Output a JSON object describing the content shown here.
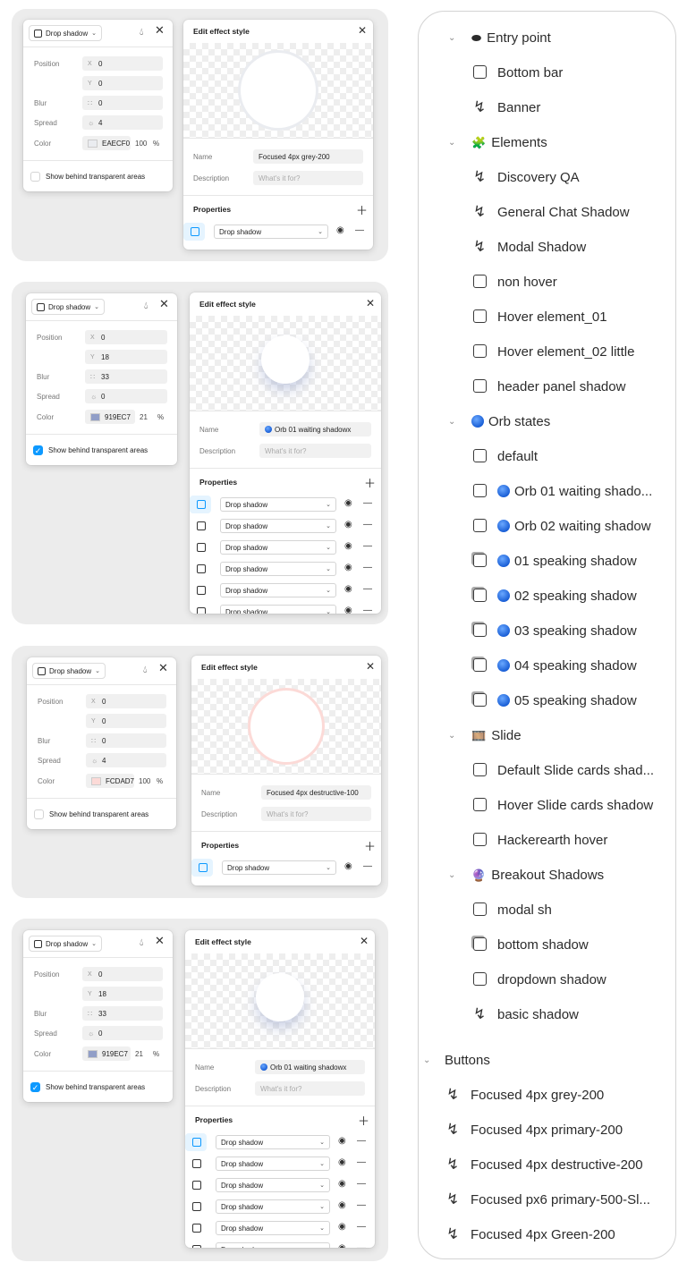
{
  "effect_panel": {
    "type_label": "Drop shadow",
    "labels": {
      "position": "Position",
      "blur": "Blur",
      "spread": "Spread",
      "color": "Color"
    },
    "axis_x": "X",
    "axis_y": "Y",
    "pct_sign": "%",
    "behind_label": "Show behind transparent areas"
  },
  "style_panel": {
    "title": "Edit effect style",
    "name_label": "Name",
    "description_label": "Description",
    "description_placeholder": "What's it for?",
    "properties_label": "Properties",
    "property_dropdown": "Drop shadow"
  },
  "blocks": [
    {
      "x": "0",
      "y": "0",
      "blur": "0",
      "spread": "4",
      "color_hex": "EAECF0",
      "swatch": "#eaecf0",
      "opacity": "100",
      "behind": false,
      "name": "Focused 4px grey-200",
      "name_dot": false,
      "property_rows": 1
    },
    {
      "x": "0",
      "y": "18",
      "blur": "33",
      "spread": "0",
      "color_hex": "919EC7",
      "swatch": "#919ec7",
      "opacity": "21",
      "behind": true,
      "name": "Orb 01 waiting shadowx",
      "name_dot": true,
      "property_rows": 6
    },
    {
      "x": "0",
      "y": "0",
      "blur": "0",
      "spread": "4",
      "color_hex": "FCDAD7",
      "swatch": "#fcdad7",
      "opacity": "100",
      "behind": false,
      "name": "Focused 4px destructive-100",
      "name_dot": false,
      "property_rows": 1
    },
    {
      "x": "0",
      "y": "18",
      "blur": "33",
      "spread": "0",
      "color_hex": "919EC7",
      "swatch": "#919ec7",
      "opacity": "21",
      "behind": true,
      "name": "Orb 01 waiting shadowx",
      "name_dot": true,
      "property_rows": 6
    }
  ],
  "styles_list": {
    "groups": [
      {
        "name": "Entry point",
        "emoji": "⬬",
        "items": [
          {
            "label": "Bottom bar",
            "icon": "square-icon"
          },
          {
            "label": "Banner",
            "icon": "bolt-icon"
          }
        ]
      },
      {
        "name": "Elements",
        "emoji": "🧩",
        "items": [
          {
            "label": "Discovery QA",
            "icon": "bolt-icon"
          },
          {
            "label": "General Chat Shadow",
            "icon": "bolt-icon"
          },
          {
            "label": "Modal Shadow",
            "icon": "bolt-icon"
          },
          {
            "label": "non hover",
            "icon": "square-icon"
          },
          {
            "label": "Hover element_01",
            "icon": "square-icon"
          },
          {
            "label": "Hover element_02 little",
            "icon": "square-icon"
          },
          {
            "label": "header panel shadow",
            "icon": "square-icon"
          }
        ]
      },
      {
        "name": "Orb states",
        "emoji": "dot",
        "items": [
          {
            "label": "default",
            "icon": "square-icon"
          },
          {
            "label": "Orb 01 waiting shado...",
            "icon": "square-icon",
            "dot": true
          },
          {
            "label": "Orb 02 waiting shadow",
            "icon": "square-icon",
            "dot": true
          },
          {
            "label": "01 speaking shadow",
            "icon": "square-shadow-icon",
            "dot": true
          },
          {
            "label": "02 speaking shadow",
            "icon": "square-shadow-icon",
            "dot": true
          },
          {
            "label": "03 speaking shadow",
            "icon": "square-shadow-icon",
            "dot": true
          },
          {
            "label": "04 speaking shadow",
            "icon": "square-shadow-icon",
            "dot": true
          },
          {
            "label": "05 speaking shadow",
            "icon": "square-shadow-icon",
            "dot": true
          }
        ]
      },
      {
        "name": "Slide",
        "emoji": "🎞️",
        "items": [
          {
            "label": "Default Slide cards shad...",
            "icon": "square-icon"
          },
          {
            "label": "Hover Slide cards shadow",
            "icon": "square-icon"
          },
          {
            "label": "Hackerearth hover",
            "icon": "square-icon"
          }
        ]
      },
      {
        "name": "Breakout Shadows",
        "emoji": "🔮",
        "items": [
          {
            "label": "modal sh",
            "icon": "square-icon"
          },
          {
            "label": "bottom shadow",
            "icon": "square-shadow-icon"
          },
          {
            "label": "dropdown shadow",
            "icon": "square-icon"
          },
          {
            "label": "basic shadow",
            "icon": "bolt-icon"
          }
        ]
      }
    ],
    "buttons_group": {
      "name": "Buttons",
      "items": [
        "Focused 4px grey-200",
        "Focused 4px primary-200",
        "Focused 4px destructive-200",
        "Focused px6 primary-500-Sl...",
        "Focused 4px Green-200"
      ]
    }
  }
}
